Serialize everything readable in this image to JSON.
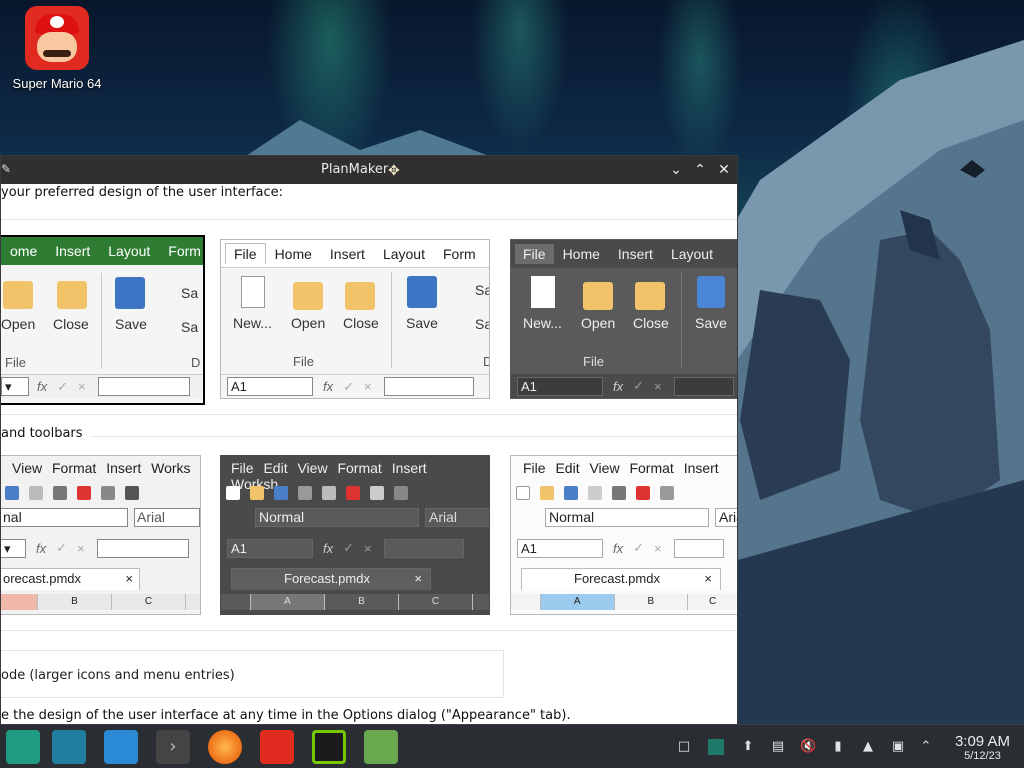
{
  "desktop": {
    "icon_label": "Super Mario 64"
  },
  "window": {
    "title": "PlanMaker",
    "intro": "your preferred design of the user interface:",
    "ribbons": [
      {
        "tabs": [
          "ome",
          "Insert",
          "Layout",
          "Form"
        ],
        "cmds": [
          "Open",
          "Close",
          "Save",
          "Sa",
          "Sa"
        ],
        "group": "File",
        "group2": "D",
        "cell": ""
      },
      {
        "tabs": [
          "File",
          "Home",
          "Insert",
          "Layout",
          "Form"
        ],
        "cmds": [
          "New...",
          "Open",
          "Close",
          "Save",
          "Sa",
          "Sa"
        ],
        "group": "File",
        "group2": "D",
        "cell": "A1"
      },
      {
        "tabs": [
          "File",
          "Home",
          "Insert",
          "Layout"
        ],
        "cmds": [
          "New...",
          "Open",
          "Close",
          "Save"
        ],
        "group": "File",
        "cell": "A1"
      }
    ],
    "menus_section": "and toolbars",
    "classic": [
      {
        "menu": [
          "View",
          "Format",
          "Insert",
          "Works"
        ],
        "style": "nal",
        "font": "Arial",
        "cell": "",
        "doc": "orecast.pmdx",
        "cols": [
          "",
          "B",
          "C"
        ]
      },
      {
        "menu": [
          "File",
          "Edit",
          "View",
          "Format",
          "Insert",
          "Worksh"
        ],
        "style": "Normal",
        "font": "Arial",
        "cell": "A1",
        "doc": "Forecast.pmdx",
        "cols": [
          "A",
          "B",
          "C"
        ]
      },
      {
        "menu": [
          "File",
          "Edit",
          "View",
          "Format",
          "Insert"
        ],
        "style": "Normal",
        "font": "Aria",
        "cell": "A1",
        "doc": "Forecast.pmdx",
        "cols": [
          "A",
          "B",
          "C"
        ]
      }
    ],
    "touch_mode": "ode (larger icons and menu entries)",
    "footer": "e the design of the user interface at any time in the Options dialog (\"Appearance\" tab).",
    "fx": "fx",
    "check": "✓",
    "cross": "×"
  },
  "taskbar": {
    "time": "3:09 AM",
    "date": "5/12/23"
  },
  "colors": {
    "green_ribbon": "#2e7d32",
    "dark_panel": "#5a5a5a",
    "titlebar": "#303030",
    "taskbar": "#2a2e32"
  }
}
